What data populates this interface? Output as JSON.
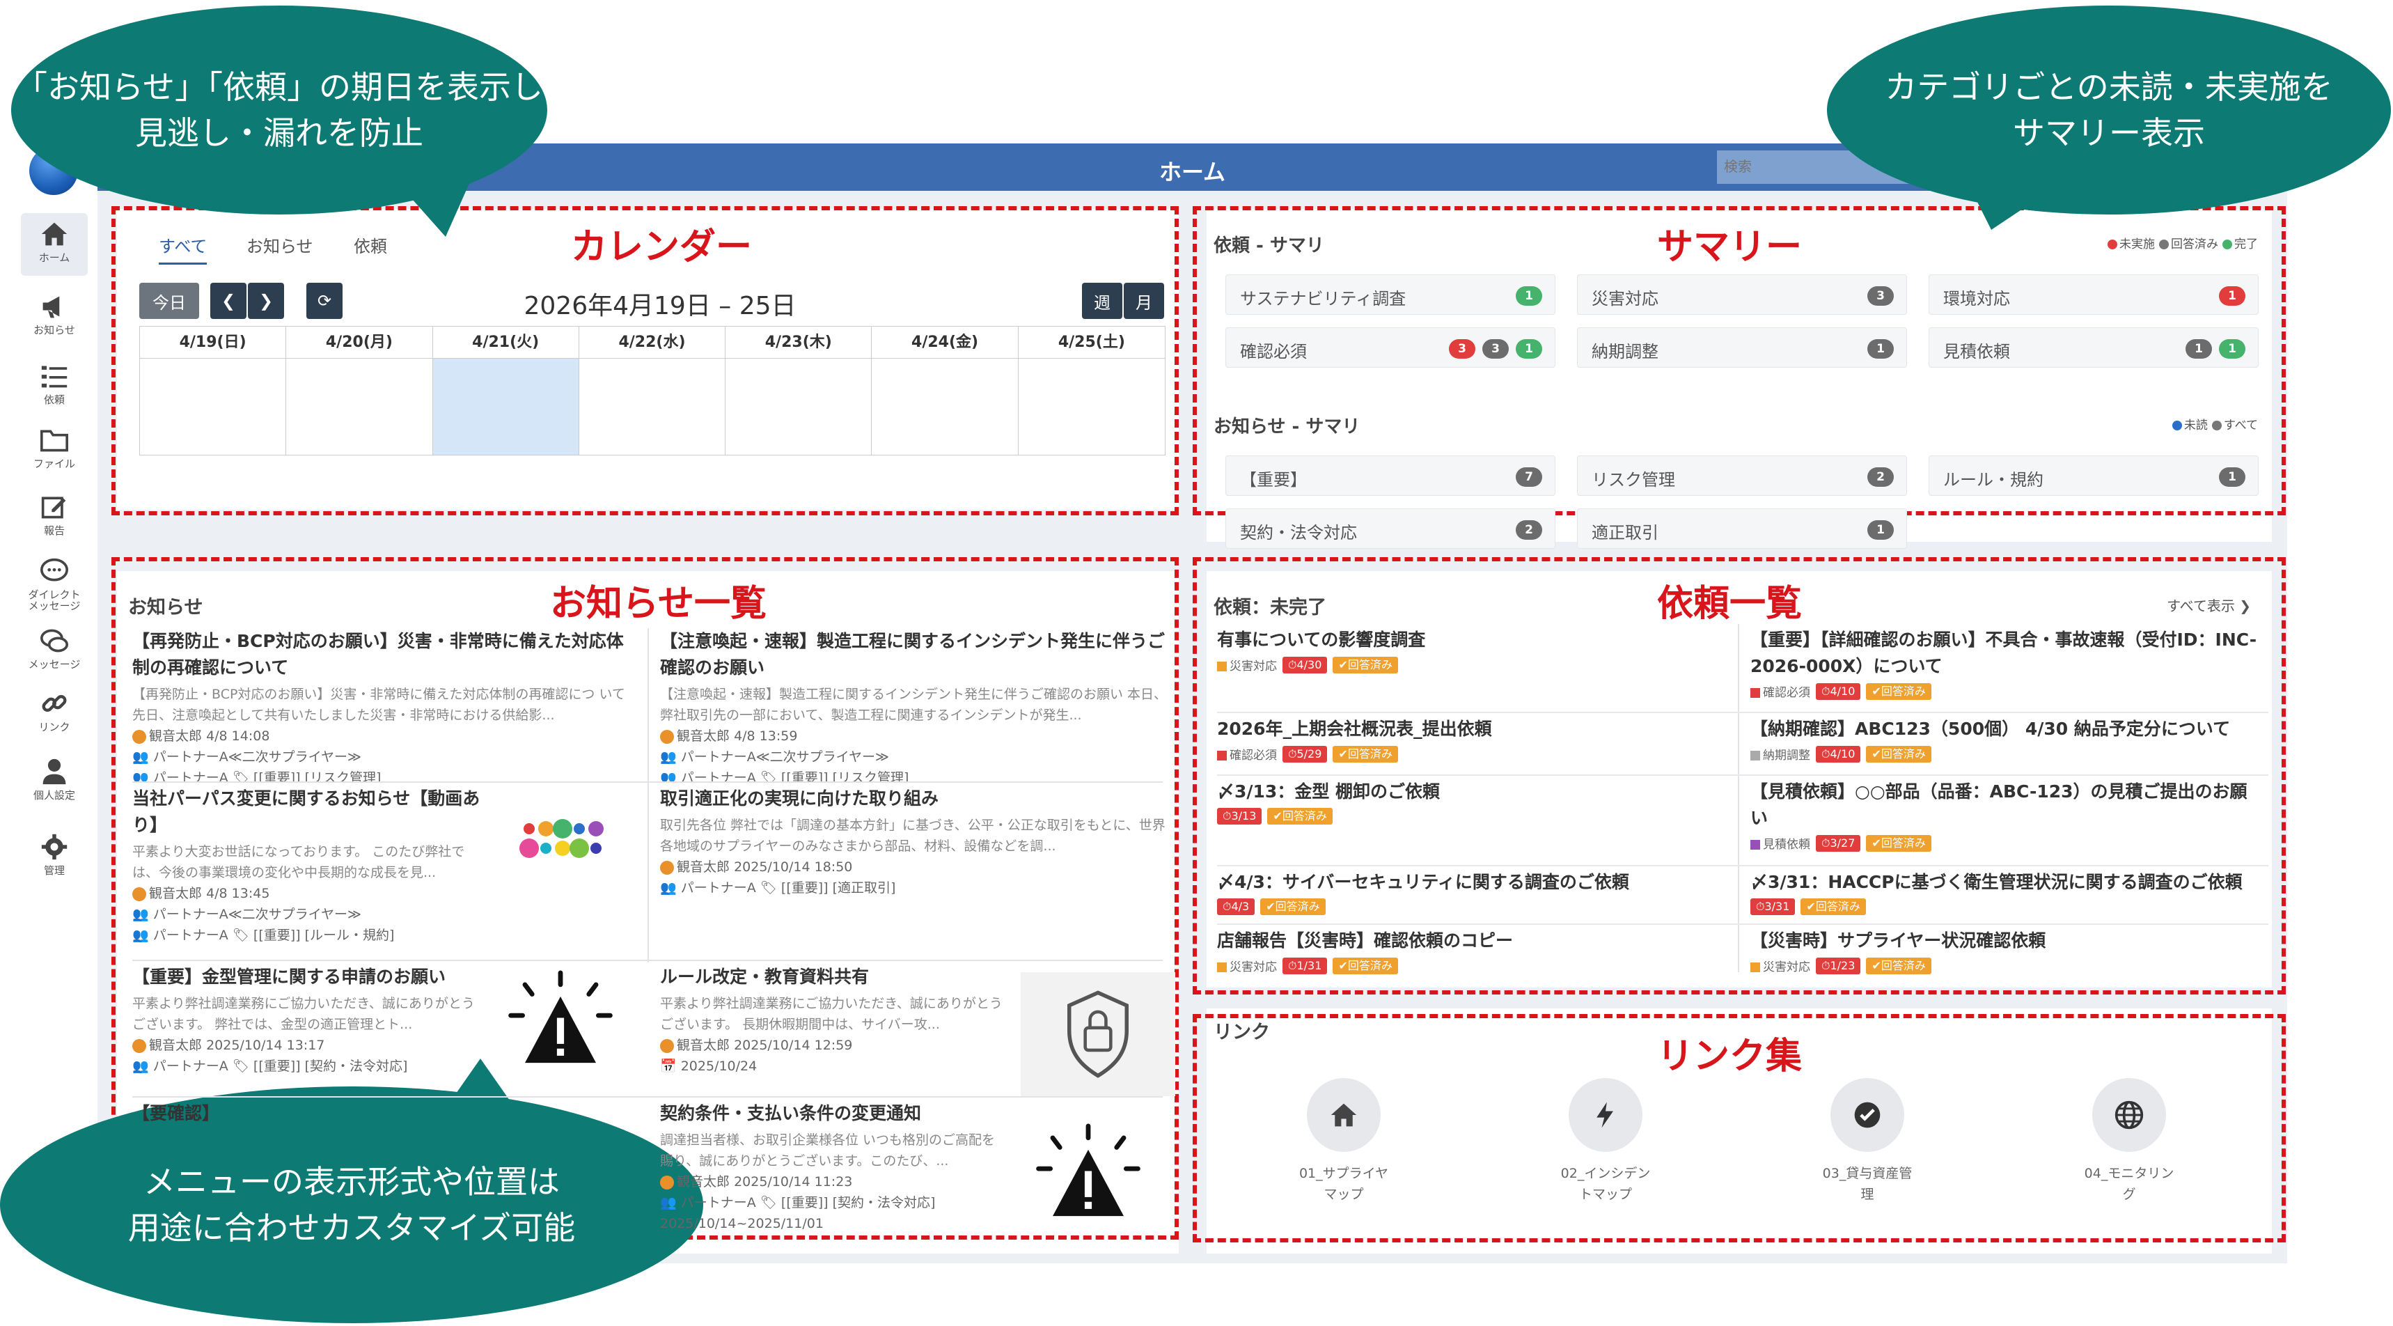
{
  "header": {
    "title": "ホーム",
    "search_placeholder": "検索"
  },
  "sidebar": {
    "items": [
      {
        "label": "ホーム",
        "icon": "home-icon"
      },
      {
        "label": "お知らせ",
        "icon": "megaphone-icon"
      },
      {
        "label": "依頼",
        "icon": "task-list-icon"
      },
      {
        "label": "ファイル",
        "icon": "folder-icon"
      },
      {
        "label": "報告",
        "icon": "edit-icon"
      },
      {
        "label": "ダイレクト\nメッセージ",
        "icon": "chat-icon"
      },
      {
        "label": "メッセージ",
        "icon": "messages-icon"
      },
      {
        "label": "リンク",
        "icon": "link-icon"
      },
      {
        "label": "個人設定",
        "icon": "user-icon"
      },
      {
        "label": "管理",
        "icon": "gear-icon"
      }
    ]
  },
  "sections": {
    "calendar": "カレンダー",
    "summary": "サマリー",
    "notices": "お知らせ一覧",
    "requests": "依頼一覧",
    "links": "リンク集"
  },
  "calendar": {
    "tabs": [
      "すべて",
      "お知らせ",
      "依頼"
    ],
    "today_btn": "今日",
    "range": "2026年4月19日 – 25日",
    "view_week": "週",
    "view_month": "月",
    "days": [
      "4/19(日)",
      "4/20(月)",
      "4/21(火)",
      "4/22(水)",
      "4/23(木)",
      "4/24(金)",
      "4/25(土)"
    ],
    "today_index": 2
  },
  "summary": {
    "req_title": "依頼 - サマリ",
    "req_legend": [
      "未実施",
      "回答済み",
      "完了"
    ],
    "req_items": [
      {
        "label": "サステナビリティ調査",
        "badges": [
          {
            "v": "1",
            "c": "g"
          }
        ]
      },
      {
        "label": "災害対応",
        "badges": [
          {
            "v": "3",
            "c": "k"
          }
        ]
      },
      {
        "label": "環境対応",
        "badges": [
          {
            "v": "1",
            "c": "r"
          }
        ]
      },
      {
        "label": "確認必須",
        "badges": [
          {
            "v": "3",
            "c": "r"
          },
          {
            "v": "3",
            "c": "k"
          },
          {
            "v": "1",
            "c": "g"
          }
        ]
      },
      {
        "label": "納期調整",
        "badges": [
          {
            "v": "1",
            "c": "k"
          }
        ]
      },
      {
        "label": "見積依頼",
        "badges": [
          {
            "v": "1",
            "c": "k"
          },
          {
            "v": "1",
            "c": "g"
          }
        ]
      }
    ],
    "notice_title": "お知らせ - サマリ",
    "notice_legend": [
      "未読",
      "すべて"
    ],
    "notice_items": [
      {
        "label": "【重要】",
        "v": "7"
      },
      {
        "label": "リスク管理",
        "v": "2"
      },
      {
        "label": "ルール・規約",
        "v": "1"
      },
      {
        "label": "契約・法令対応",
        "v": "2"
      },
      {
        "label": "適正取引",
        "v": "1"
      }
    ]
  },
  "notices": {
    "title": "お知らせ",
    "items": [
      {
        "title": "【再発防止・BCP対応のお願い】災害・非常時に備えた対応体制の再確認について",
        "preview": "【再発防止・BCP対応のお願い】災害・非常時に備えた対応体制の再確認につ いて 先日、注意喚起として共有いたしました災害・非常時における供給影...",
        "author": "観音太郎",
        "date": "4/8 14:08",
        "group": "パートナーA≪二次サプライヤー≫",
        "partner": "パートナーA",
        "tags": "[[重要]] [リスク管理]"
      },
      {
        "title": "【注意喚起・速報】製造工程に関するインシデント発生に伴うご確認のお願い",
        "preview": "【注意喚起・速報】製造工程に関するインシデント発生に伴うご確認のお願い 本日、弊社取引先の一部において、製造工程に関連するインシデントが発生...",
        "author": "観音太郎",
        "date": "4/8 13:59",
        "group": "パートナーA≪二次サプライヤー≫",
        "partner": "パートナーA",
        "tags": "[[重要]] [リスク管理]"
      },
      {
        "title": "当社パーパス変更に関するお知らせ【動画あり】",
        "preview": "平素より大変お世話になっております。 このたび弊社では、今後の事業環境の変化や中長期的な成長を見...",
        "author": "観音太郎",
        "date": "4/8 13:45",
        "group": "パートナーA≪二次サプライヤー≫",
        "partner": "パートナーA",
        "tags": "[[重要]] [ルール・規約]"
      },
      {
        "title": "取引適正化の実現に向けた取り組み",
        "preview": "取引先各位 弊社では「調達の基本方針」に基づき、公平・公正な取引をもとに、世界各地域のサプライヤーのみなさまから部品、材料、設備などを調...",
        "author": "観音太郎",
        "date": "2025/10/14 18:50",
        "partner": "パートナーA",
        "tags": "[[重要]] [適正取引]"
      },
      {
        "title": "【重要】金型管理に関する申請のお願い",
        "preview": "平素より弊社調達業務にご協力いただき、誠にありがとうございます。 弊社では、金型の適正管理とト...",
        "author": "観音太郎",
        "date": "2025/10/14 13:17",
        "partner": "パートナーA",
        "tags": "[[重要]] [契約・法令対応]"
      },
      {
        "title": "ルール改定・教育資料共有",
        "preview": "平素より弊社調達業務にご協力いただき、誠にありがとうございます。 長期休暇期間中は、サイバー攻...",
        "author": "観音太郎",
        "date": "2025/10/14 12:59",
        "due": "2025/10/24"
      },
      {
        "title": "【要確認】",
        "preview": ""
      },
      {
        "title": "契約条件・支払い条件の変更通知",
        "preview": "調達担当者様、お取引企業様各位 いつも格別のご高配を賜り、誠にありがとうございます。このたび、...",
        "author": "観音太郎",
        "date": "2025/10/14 11:23",
        "partner": "パートナーA",
        "tags": "[[重要]] [契約・法令対応]",
        "period": "2025/10/14~2025/11/01"
      }
    ]
  },
  "requests": {
    "title": "依頼：未完了",
    "show_all": "すべて表示",
    "items": [
      {
        "title": "有事についての影響度調査",
        "cat": "災害対応",
        "cat_color": "#f0a02c",
        "due": "4/30",
        "status": "回答済み"
      },
      {
        "title": "【重要】【詳細確認のお願い】不具合・事故速報（受付ID：INC-2026-000X）について",
        "cat": "確認必須",
        "cat_color": "#e23d3d",
        "due": "4/10",
        "status": "回答済み"
      },
      {
        "title": "2026年_上期会社概況表_提出依頼",
        "cat": "確認必須",
        "cat_color": "#e23d3d",
        "due": "5/29",
        "status": "回答済み"
      },
      {
        "title": "【納期確認】ABC123（500個） 4/30 納品予定分について",
        "cat": "納期調整",
        "cat_color": "#aaaaaa",
        "due": "4/10",
        "status": "回答済み"
      },
      {
        "title": "〆3/13：金型 棚卸のご依頼",
        "cat": "",
        "due": "3/13",
        "status": "回答済み"
      },
      {
        "title": "【見積依頼】○○部品（品番：ABC-123）の見積ご提出のお願い",
        "cat": "見積依頼",
        "cat_color": "#9a4fb8",
        "due": "3/27",
        "status": "回答済み"
      },
      {
        "title": "〆4/3：サイバーセキュリティに関する調査のご依頼",
        "cat": "",
        "due": "4/3",
        "status": "回答済み"
      },
      {
        "title": "〆3/31：HACCPに基づく衛生管理状況に関する調査のご依頼",
        "cat": "",
        "due": "3/31",
        "status": "回答済み"
      },
      {
        "title": "店舗報告【災害時】確認依頼のコピー",
        "cat": "災害対応",
        "cat_color": "#f0a02c",
        "due": "1/31",
        "status": "回答済み"
      },
      {
        "title": "【災害時】サプライヤー状況確認依頼",
        "cat": "災害対応",
        "cat_color": "#f0a02c",
        "due": "1/23",
        "status": "回答済み"
      }
    ]
  },
  "links": {
    "title": "リンク",
    "items": [
      {
        "label": "01_サプライヤ\nマップ",
        "icon": "home-icon"
      },
      {
        "label": "02_インシデン\nトマップ",
        "icon": "bolt-icon"
      },
      {
        "label": "03_貸与資産管\n理",
        "icon": "check-circle-icon"
      },
      {
        "label": "04_モニタリン\nグ",
        "icon": "globe-icon"
      }
    ]
  },
  "callouts": {
    "top_left": "「お知らせ」「依頼」の期日を表示し\n見逃し・漏れを防止",
    "top_right": "カテゴリごとの未読・未実施を\nサマリー表示",
    "bottom_left": "メニューの表示形式や位置は\n用途に合わせカスタマイズ可能"
  },
  "colors": {
    "header": "#3d6db0",
    "callout": "#0d7a73",
    "highlight": "#d9151c"
  }
}
